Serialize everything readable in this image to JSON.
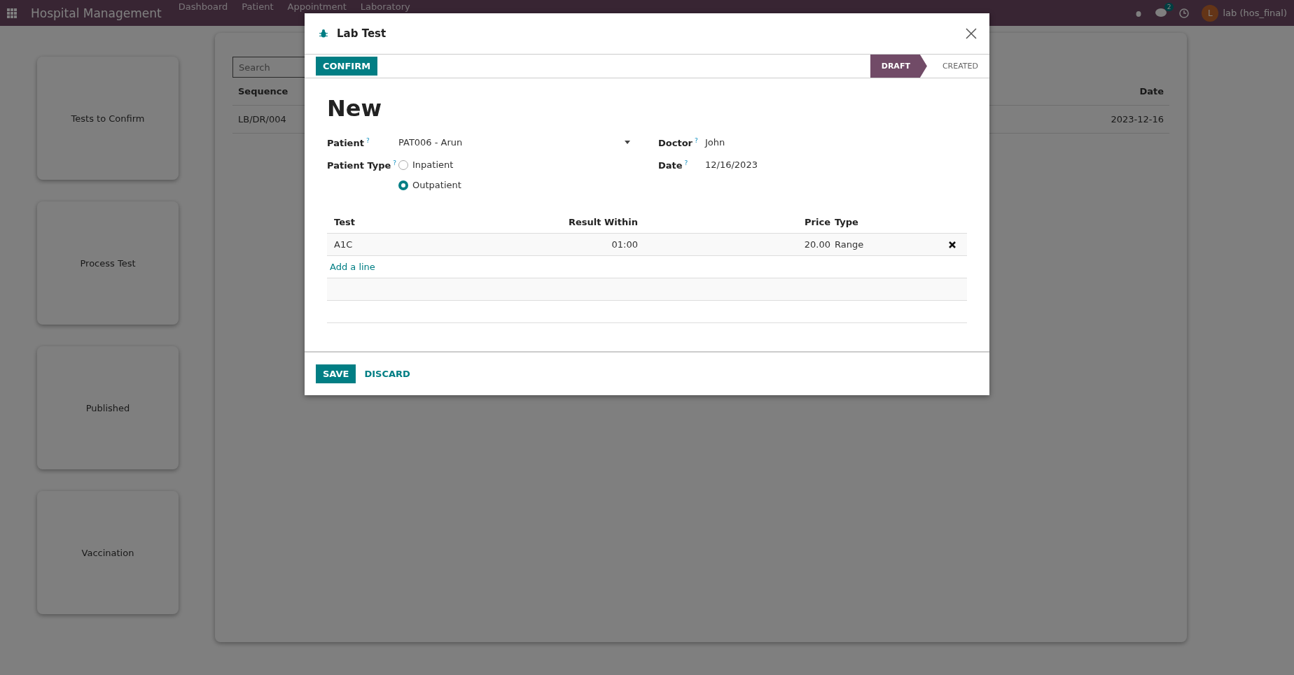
{
  "navbar": {
    "app_name": "Hospital Management",
    "menu": [
      "Dashboard",
      "Patient",
      "Appointment",
      "Laboratory"
    ],
    "chat_count": "2",
    "user_initial": "L",
    "user": "lab (hos_final)"
  },
  "dashboard_cards": [
    "Tests to Confirm",
    "Process Test",
    "Published",
    "Vaccination"
  ],
  "list": {
    "search_placeholder": "Search",
    "columns": [
      "Sequence",
      "Date"
    ],
    "rows": [
      {
        "sequence": "LB/DR/004",
        "date": "2023-12-16"
      }
    ]
  },
  "dialog": {
    "title": "Lab Test",
    "confirm": "CONFIRM",
    "stages": [
      {
        "label": "DRAFT",
        "selected": true
      },
      {
        "label": "CREATED",
        "selected": false
      }
    ],
    "record_name": "New",
    "fields": {
      "patient_label": "Patient",
      "patient": "PAT006 - Arun",
      "doctor_label": "Doctor",
      "doctor": "John",
      "patient_type_label": "Patient Type",
      "date_label": "Date",
      "date": "12/16/2023",
      "help_mark": "?"
    },
    "patient_types": [
      {
        "label": "Inpatient",
        "selected": false
      },
      {
        "label": "Outpatient",
        "selected": true
      }
    ],
    "table": {
      "columns": [
        "Test",
        "Result Within",
        "Price",
        "Type"
      ],
      "rows": [
        {
          "test": "A1C",
          "result_within": "01:00",
          "price": "20.00",
          "type": "Range"
        }
      ],
      "add_line": "Add a line"
    },
    "save": "SAVE",
    "discard": "DISCARD"
  }
}
